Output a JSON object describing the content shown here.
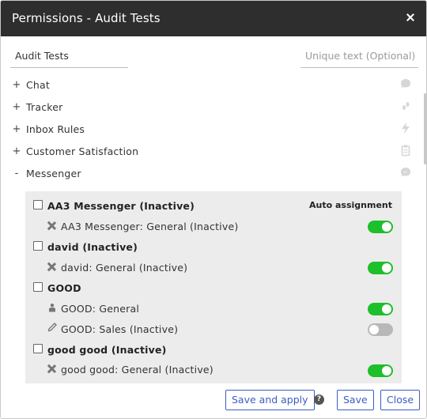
{
  "header": {
    "title": "Permissions - Audit Tests"
  },
  "filters": {
    "name_value": "Audit Tests",
    "unique_placeholder": "Unique text (Optional)"
  },
  "tree": [
    {
      "toggle": "+",
      "label": "Chat",
      "icon": "chat-bubble-icon"
    },
    {
      "toggle": "+",
      "label": "Tracker",
      "icon": "footprint-icon"
    },
    {
      "toggle": "+",
      "label": "Inbox Rules",
      "icon": "lightning-icon"
    },
    {
      "toggle": "+",
      "label": "Customer Satisfaction",
      "icon": "clipboard-icon"
    },
    {
      "toggle": "-",
      "label": "Messenger",
      "icon": "messenger-icon"
    }
  ],
  "messenger": {
    "auto_assignment_label": "Auto assignment",
    "groups": [
      {
        "label": "AA3 Messenger (Inactive)",
        "sub": {
          "label": "AA3 Messenger: General (Inactive)",
          "icon": "x-icon",
          "auto": true
        }
      },
      {
        "label": "david (Inactive)",
        "sub": {
          "label": "david: General (Inactive)",
          "icon": "x-icon",
          "auto": true
        }
      },
      {
        "label": "GOOD",
        "subs": [
          {
            "label": "GOOD: General",
            "icon": "person-icon",
            "auto": true
          },
          {
            "label": "GOOD: Sales (Inactive)",
            "icon": "pencil-icon",
            "auto": false
          }
        ]
      },
      {
        "label": "good good (Inactive)",
        "sub": {
          "label": "good good: General (Inactive)",
          "icon": "x-icon",
          "auto": true
        }
      }
    ]
  },
  "footer": {
    "save_apply_label": "Save and apply",
    "help_label": "?",
    "save_label": "Save",
    "close_label": "Close"
  },
  "colors": {
    "header_bg": "#2e2e2e",
    "toggle_on": "#1dbf2a",
    "toggle_off": "#b8b8b8",
    "button_accent": "#3b5fc0"
  }
}
